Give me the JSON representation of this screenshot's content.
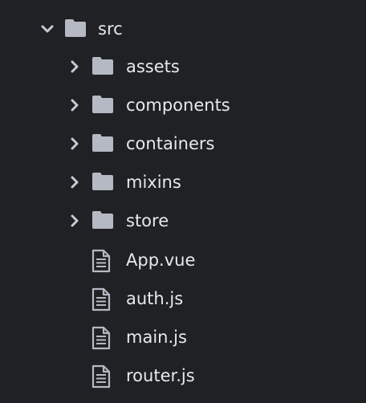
{
  "tree": {
    "root": {
      "label": "src",
      "expanded": true,
      "icon": "folder-icon"
    },
    "children": [
      {
        "label": "assets",
        "type": "folder",
        "expanded": false,
        "icon": "folder-icon"
      },
      {
        "label": "components",
        "type": "folder",
        "expanded": false,
        "icon": "folder-icon"
      },
      {
        "label": "containers",
        "type": "folder",
        "expanded": false,
        "icon": "folder-icon"
      },
      {
        "label": "mixins",
        "type": "folder",
        "expanded": false,
        "icon": "folder-icon"
      },
      {
        "label": "store",
        "type": "folder",
        "expanded": false,
        "icon": "folder-icon"
      },
      {
        "label": "App.vue",
        "type": "file",
        "icon": "file-text-icon"
      },
      {
        "label": "auth.js",
        "type": "file",
        "icon": "file-text-icon"
      },
      {
        "label": "main.js",
        "type": "file",
        "icon": "file-text-icon"
      },
      {
        "label": "router.js",
        "type": "file",
        "icon": "file-text-icon"
      }
    ]
  },
  "colors": {
    "background": "#1f2124",
    "text": "#e7e9ec",
    "icon": "#b5b9c4"
  }
}
